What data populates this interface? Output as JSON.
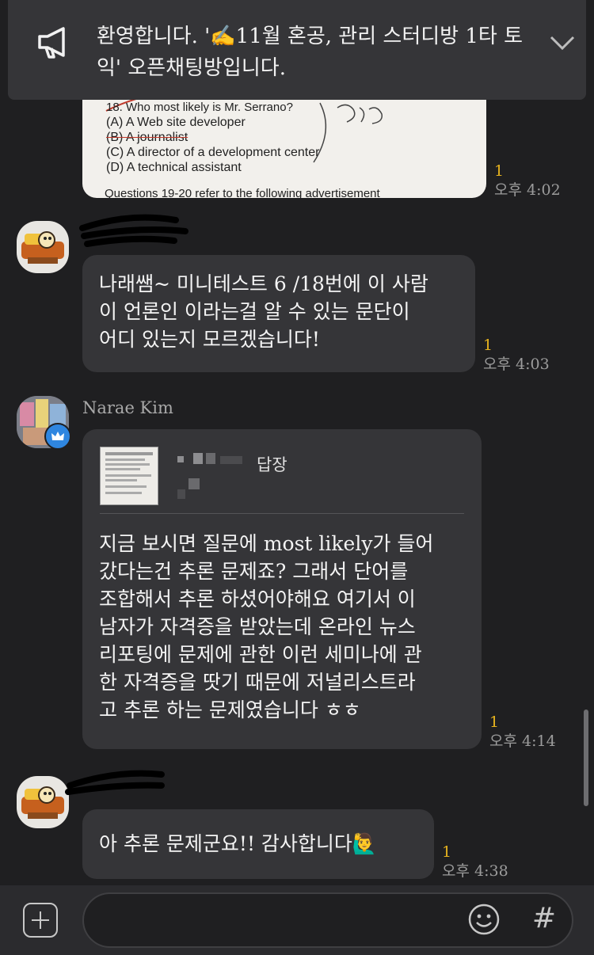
{
  "notice": {
    "icon": "megaphone-icon",
    "text": "환영합니다. '✍11월 혼공, 관리 스터디방 1타 토익' 오픈채팅방입니다."
  },
  "messages": [
    {
      "type": "image",
      "image_text": {
        "question": "18. Who most likely is Mr. Serrano?",
        "options": [
          "(A) A Web site developer",
          "(B) A journalist",
          "(C) A director of a development center",
          "(D) A technical assistant"
        ],
        "footer": "Questions 19-20 refer to the following advertisement"
      },
      "unread": "1",
      "time": "오후 4:02"
    },
    {
      "type": "text",
      "lines": [
        "나래쌤~ 미니테스트 6 /18번에 이 사람",
        "이 언론인 이라는걸 알 수 있는 문단이",
        "어디 있는지 모르겠습니다!"
      ],
      "unread": "1",
      "time": "오후 4:03"
    },
    {
      "type": "reply",
      "sender": "Narae Kim",
      "reply_label": "답장",
      "lines": [
        "지금 보시면 질문에 most likely가 들어",
        "갔다는건 추론 문제죠? 그래서 단어를",
        "조합해서 추론 하셨어야해요 여기서 이",
        "남자가 자격증을 받았는데 온라인 뉴스",
        "리포팅에 문제에 관한 이런 세미나에 관",
        "한 자격증을 땃기 때문에 저널리스트라",
        "고 추론 하는 문제였습니다 ㅎㅎ"
      ],
      "unread": "1",
      "time": "오후 4:14"
    },
    {
      "type": "text",
      "lines": [
        "아 추론 문제군요!! 감사합니다🙋‍♂️"
      ],
      "unread": "1",
      "time": "오후 4:38"
    }
  ],
  "composer": {
    "placeholder": "",
    "plus_icon": "plus-icon",
    "emoji_icon": "emoji-icon",
    "hash_label": "#"
  }
}
